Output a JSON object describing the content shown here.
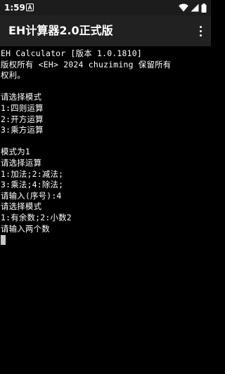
{
  "status_bar": {
    "time": "1:59",
    "notification_icon": "notification-a-icon",
    "right_icons": [
      "wifi-icon",
      "signal-icon",
      "battery-icon"
    ]
  },
  "app_bar": {
    "title": "EH计算器2.0正式版",
    "menu_icon": "more-vert-icon"
  },
  "terminal": {
    "lines": [
      "EH Calculator [版本 1.0.1810]",
      "版权所有 <EH> 2024 chuziming 保留所有",
      "权利。",
      "",
      "请选择模式",
      "1:四则运算",
      "2:开方运算",
      "3:乘方运算",
      "",
      "模式为1",
      "请选择运算",
      "1:加法;2:减法;",
      "3:乘法;4:除法;",
      "请输入(序号):4",
      "请选择模式",
      "1:有余数;2:小数2",
      "请输入两个数"
    ]
  },
  "colors": {
    "background": "#000000",
    "status_bar": "#1c1c1c",
    "app_bar": "#212121",
    "text": "#ffffff",
    "cursor": "#c8c8c8"
  }
}
